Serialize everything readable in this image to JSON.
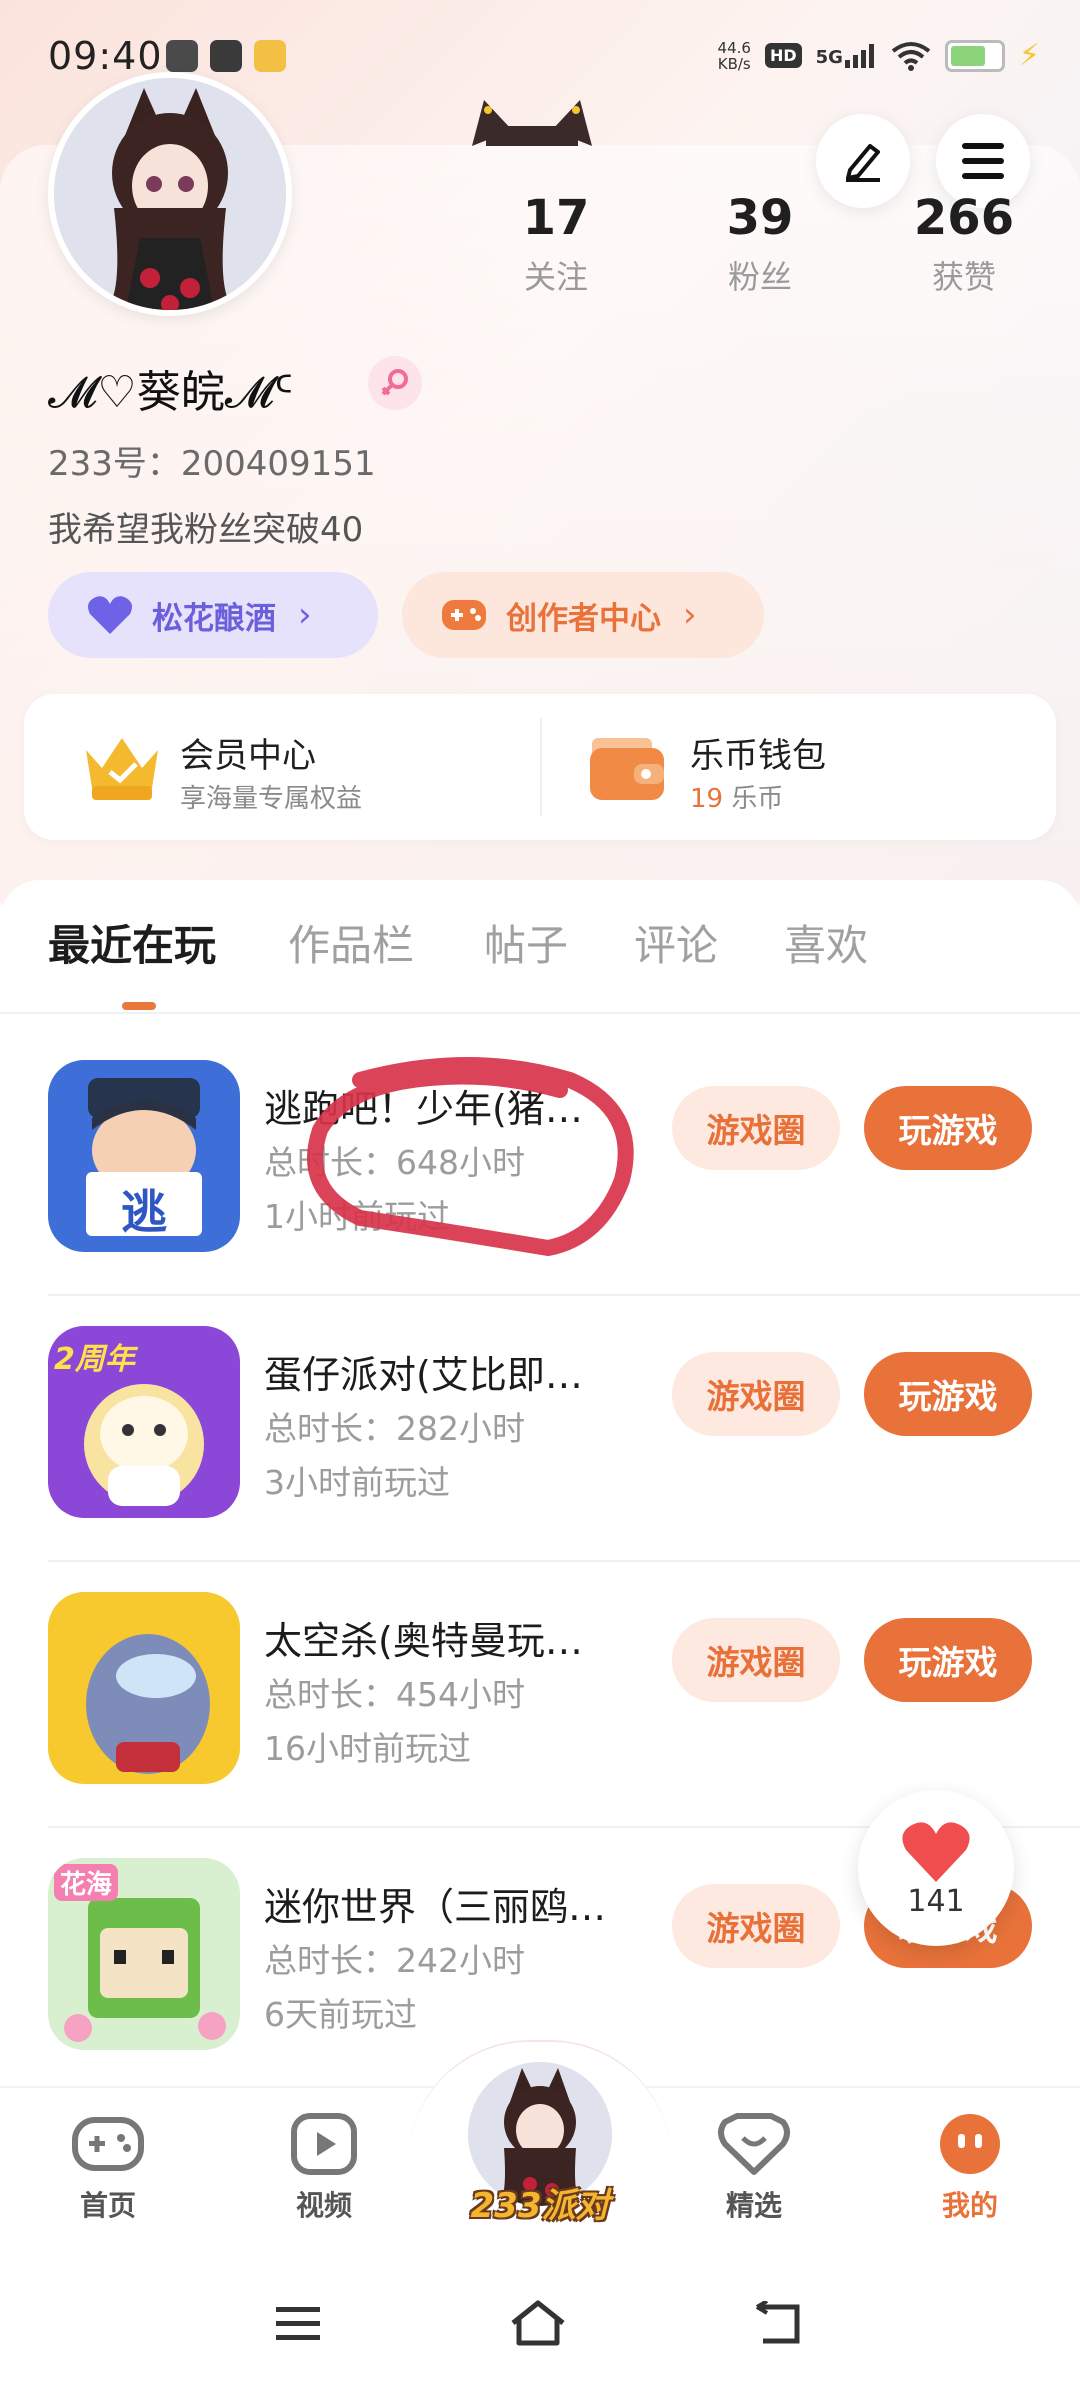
{
  "status_bar": {
    "time": "09:40",
    "net_speed_value": "44.6",
    "net_speed_unit": "KB/s",
    "hd_label": "HD",
    "network_type": "5G",
    "battery_level": 0.8
  },
  "profile": {
    "stats": [
      {
        "count": "17",
        "label": "关注"
      },
      {
        "count": "39",
        "label": "粉丝"
      },
      {
        "count": "266",
        "label": "获赞"
      }
    ],
    "nickname": "𝓜♡葵皖𝓜ᑦ",
    "uid_text": "233号：200409151",
    "bio": "我希望我粉丝突破40",
    "pills": [
      {
        "label": "松花酿酒",
        "icon": "heart-icon"
      },
      {
        "label": "创作者中心",
        "icon": "gamepad-icon"
      }
    ]
  },
  "member_card": {
    "vip_title": "会员中心",
    "vip_sub": "享海量专属权益",
    "wallet_title": "乐币钱包",
    "wallet_amount": "19",
    "wallet_unit": "乐币"
  },
  "tabs": [
    "最近在玩",
    "作品栏",
    "帖子",
    "评论",
    "喜欢"
  ],
  "active_tab": 0,
  "games": [
    {
      "name": "逃跑吧！少年(猪…",
      "duration": "总时长：648小时",
      "last_played": "1小时前玩过",
      "circle_label": "游戏圈",
      "play_label": "玩游戏",
      "icon_text": "逃"
    },
    {
      "name": "蛋仔派对(艾比即…",
      "duration": "总时长：282小时",
      "last_played": "3小时前玩过",
      "circle_label": "游戏圈",
      "play_label": "玩游戏",
      "icon_text": "2周年"
    },
    {
      "name": "太空杀(奥特曼玩…",
      "duration": "总时长：454小时",
      "last_played": "16小时前玩过",
      "circle_label": "游戏圈",
      "play_label": "玩游戏",
      "icon_text": ""
    },
    {
      "name": "迷你世界（三丽鸥…",
      "duration": "总时长：242小时",
      "last_played": "6天前玩过",
      "circle_label": "游戏圈",
      "play_label": "玩游戏",
      "icon_text": "花海"
    }
  ],
  "like_bubble": {
    "count": "141"
  },
  "bottom_nav": [
    {
      "label": "首页",
      "icon": "gamepad-icon"
    },
    {
      "label": "视频",
      "icon": "play-icon"
    },
    {
      "label": "233派对",
      "icon": "avatar"
    },
    {
      "label": "精选",
      "icon": "heart-badge-icon"
    },
    {
      "label": "我的",
      "icon": "face-icon"
    }
  ],
  "colors": {
    "accent": "#e8723a",
    "accent_light": "#fde9df",
    "purple_pill": "#e6e2fb",
    "orange_pill": "#fde7dc"
  }
}
